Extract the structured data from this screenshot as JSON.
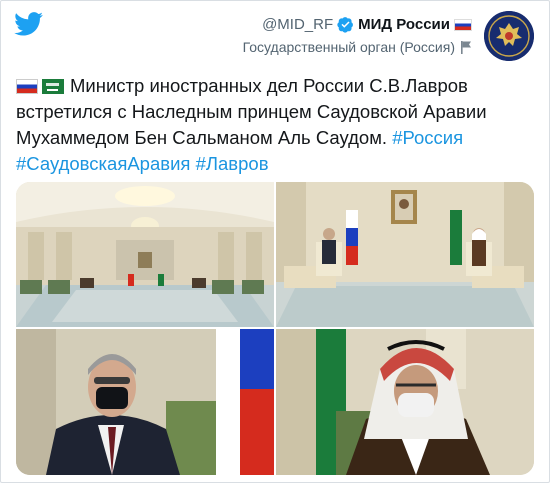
{
  "header": {
    "handle": "@MID_RF",
    "display_name": "МИД России",
    "subtitle": "Государственный орган (Россия)"
  },
  "tweet": {
    "text": "Министр иностранных дел России С.В.Лавров встретился с Наследным принцем Саудовской Аравии Мухаммедом Бен Сальманом Аль Саудом.",
    "hashtags": [
      "#Россия",
      "#СаудовскаяАравия",
      "#Лавров"
    ]
  },
  "icons": {
    "logo": "twitter-bird-icon",
    "verified": "verified-badge-icon",
    "flag_russia": "russia-flag-icon",
    "flag_saudi": "saudi-flag-icon",
    "gov_label": "government-flag-icon",
    "avatar": "emblem-avatar"
  },
  "colors": {
    "brand": "#1da1f2",
    "link": "#1b95e0",
    "text": "#14171a",
    "muted": "#536471"
  }
}
